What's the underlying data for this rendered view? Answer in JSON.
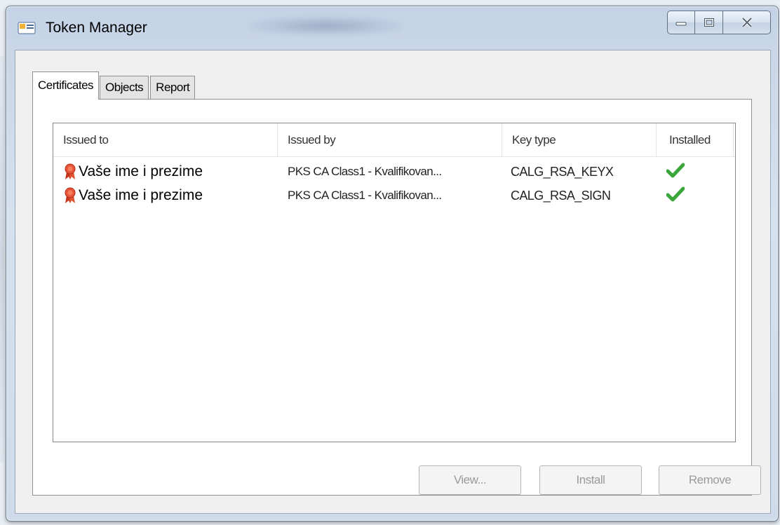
{
  "window": {
    "title": "Token Manager",
    "controls": {
      "minimize": "minimize",
      "maximize": "maximize",
      "close": "close"
    }
  },
  "tabs": [
    {
      "label": "Certificates",
      "active": true
    },
    {
      "label": "Objects",
      "active": false
    },
    {
      "label": "Report",
      "active": false
    }
  ],
  "list": {
    "columns": [
      "Issued to",
      "Issued by",
      "Key type",
      "Installed"
    ],
    "rows": [
      {
        "issued_to": "Vaše ime i prezime",
        "issued_by": "PKS CA Class1 - Kvalifikovan...",
        "key_type": "CALG_RSA_KEYX",
        "installed_icon": "checkmark-icon",
        "row_icon": "certificate-icon"
      },
      {
        "issued_to": "Vaše ime i prezime",
        "issued_by": "PKS CA Class1 - Kvalifikovan...",
        "key_type": "CALG_RSA_SIGN",
        "installed_icon": "checkmark-icon",
        "row_icon": "certificate-icon"
      }
    ]
  },
  "buttons": {
    "view": "View...",
    "install": "Install",
    "remove": "Remove"
  },
  "colors": {
    "check": "#3aa53a",
    "cert_ribbon": "#d9472b"
  }
}
